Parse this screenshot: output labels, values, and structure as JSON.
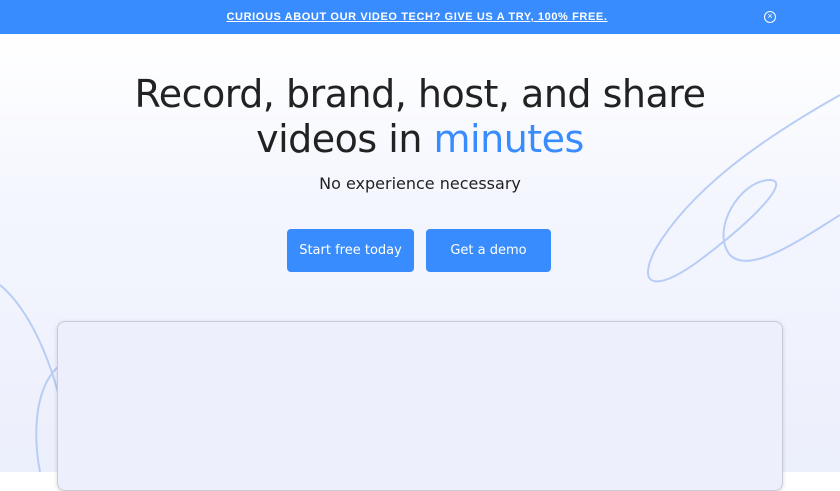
{
  "banner": {
    "text": "CURIOUS ABOUT OUR VIDEO TECH? GIVE US A TRY, 100% FREE.",
    "close_icon": "close-circle-icon"
  },
  "hero": {
    "title_line1": "Record, brand, host, and share",
    "title_line2_prefix": "videos in ",
    "title_highlight": "minutes",
    "subtitle": "No experience necessary"
  },
  "buttons": {
    "start": "Start free today",
    "demo": "Get a demo"
  },
  "colors": {
    "accent": "#388cfd",
    "text": "#222222"
  }
}
